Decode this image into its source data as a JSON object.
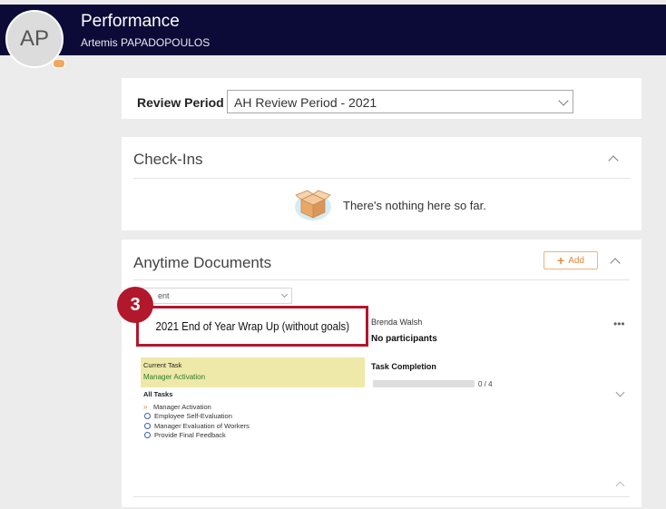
{
  "header": {
    "title": "Performance",
    "user_name": "Artemis PAPADOPOULOS",
    "avatar_initials": "AP"
  },
  "review_period": {
    "label": "Review Period",
    "selected": "AH Review Period - 2021"
  },
  "checkins": {
    "title": "Check-Ins",
    "empty_message": "There's nothing here so far.",
    "empty_icon": "empty-box-icon"
  },
  "anytime_documents": {
    "title": "Anytime Documents",
    "add_label": "Add",
    "filter_value": "ent",
    "step_number": "3",
    "document": {
      "title": "2021 End of Year Wrap Up (without goals)",
      "owner": "Brenda Walsh",
      "participants": "No participants",
      "current_task_label": "Current Task",
      "current_task_value": "Manager Activation",
      "task_completion_label": "Task Completion",
      "task_completion_value": "0 / 4",
      "task_completion_fraction": 0,
      "all_tasks_label": "All Tasks",
      "tasks": [
        {
          "label": "Manager Activation",
          "state": "current"
        },
        {
          "label": "Employee Self-Evaluation",
          "state": "pending"
        },
        {
          "label": "Manager Evaluation of Workers",
          "state": "pending"
        },
        {
          "label": "Provide Final Feedback",
          "state": "pending"
        }
      ]
    }
  },
  "colors": {
    "header_bg": "#0c0a37",
    "accent": "#e0913e",
    "highlight_red": "#b3172b",
    "current_task_bg": "#efe9a9"
  }
}
